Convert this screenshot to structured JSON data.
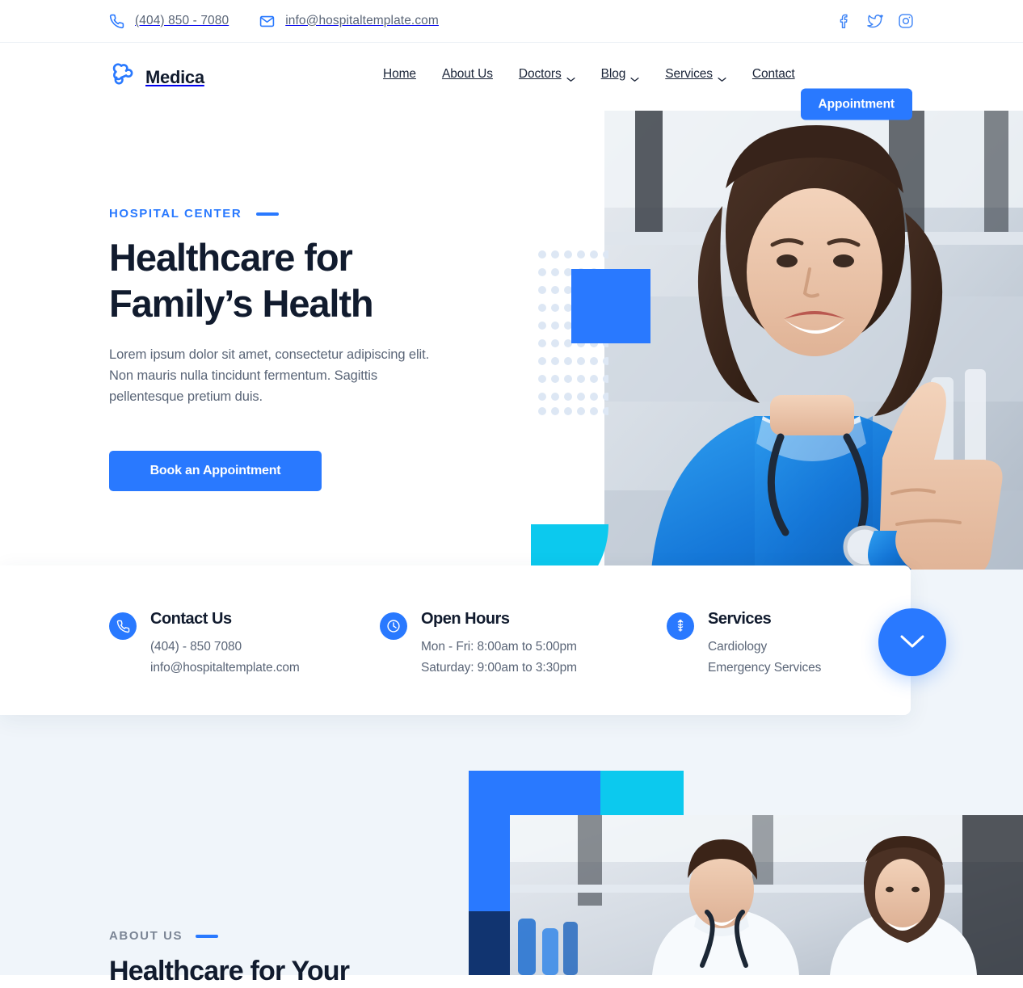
{
  "topbar": {
    "phone": "(404) 850 - 7080",
    "email": "info@hospitaltemplate.com",
    "phone_icon": "phone-icon",
    "email_icon": "mail-icon",
    "social": [
      {
        "name": "facebook-icon",
        "label": "Facebook"
      },
      {
        "name": "twitter-icon",
        "label": "Twitter"
      },
      {
        "name": "instagram-icon",
        "label": "Instagram"
      }
    ]
  },
  "nav": {
    "logo_text": "Medica",
    "logo_icon": "medical-cross-logo-icon",
    "links": [
      {
        "label": "Home",
        "has_dropdown": false
      },
      {
        "label": "About Us",
        "has_dropdown": false
      },
      {
        "label": "Doctors",
        "has_dropdown": true
      },
      {
        "label": "Blog",
        "has_dropdown": true
      },
      {
        "label": "Services",
        "has_dropdown": true
      },
      {
        "label": "Contact",
        "has_dropdown": false
      }
    ],
    "cta_label": "Appointment"
  },
  "hero": {
    "eyebrow": "HOSPITAL CENTER",
    "heading_line1": "Healthcare for",
    "heading_line2": "Family’s Health",
    "paragraph": "Lorem ipsum dolor sit amet, consectetur adipiscing elit. Non mauris nulla tincidunt fermentum. Sagittis pellentesque pretium duis.",
    "cta_label": "Book an Appointment",
    "image_alt": "smiling female doctor in blue scrubs giving a thumbs up"
  },
  "info_cards": [
    {
      "icon": "phone-icon",
      "title": "Contact Us",
      "line1": "(404) - 850  7080",
      "line2": "info@hospitaltemplate.com"
    },
    {
      "icon": "clock-icon",
      "title": "Open Hours",
      "line1": "Mon - Fri: 8:00am to 5:00pm",
      "line2": "Saturday: 9:00am to 3:30pm"
    },
    {
      "icon": "caduceus-icon",
      "title": "Services",
      "line1": "Cardiology",
      "line2": "Emergency Services"
    }
  ],
  "scroll_button": {
    "icon": "chevron-down-icon",
    "label": "Scroll down"
  },
  "about": {
    "eyebrow": "ABOUT US",
    "heading": "Healthcare for Your",
    "image_alt": "male and female doctors reviewing notes in a laboratory"
  },
  "colors": {
    "primary_blue": "#2979ff",
    "cyan": "#0cc9ee",
    "navy": "#113470",
    "dark_text": "#111b2e",
    "muted_text": "#5a6577",
    "page_bg": "#f0f5fa",
    "dot_grid": "#dde7f4"
  }
}
